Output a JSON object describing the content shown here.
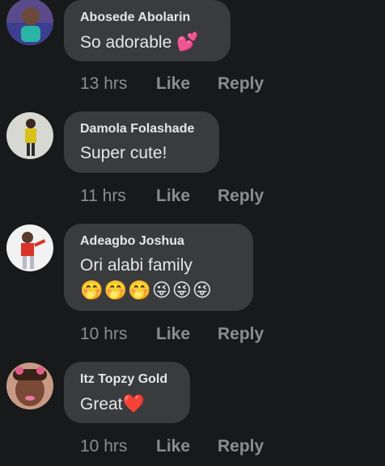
{
  "comments": [
    {
      "author": "Abosede Abolarin",
      "text": "So adorable",
      "emoji": "💕",
      "time": "13 hrs",
      "like_label": "Like",
      "reply_label": "Reply"
    },
    {
      "author": "Damola Folashade",
      "text": "Super cute!",
      "time": "11 hrs",
      "like_label": "Like",
      "reply_label": "Reply"
    },
    {
      "author": "Adeagbo Joshua",
      "text": "Ori alabi family",
      "emoji": "🤭🤭🤭😜😜😜",
      "time": "10 hrs",
      "like_label": "Like",
      "reply_label": "Reply"
    },
    {
      "author": "Itz Topzy Gold",
      "text": "Great",
      "emoji": "❤️",
      "time": "10 hrs",
      "like_label": "Like",
      "reply_label": "Reply"
    }
  ],
  "colors": {
    "background": "#18191a",
    "bubble": "#3a3b3c",
    "secondary_text": "#8a8d91"
  }
}
